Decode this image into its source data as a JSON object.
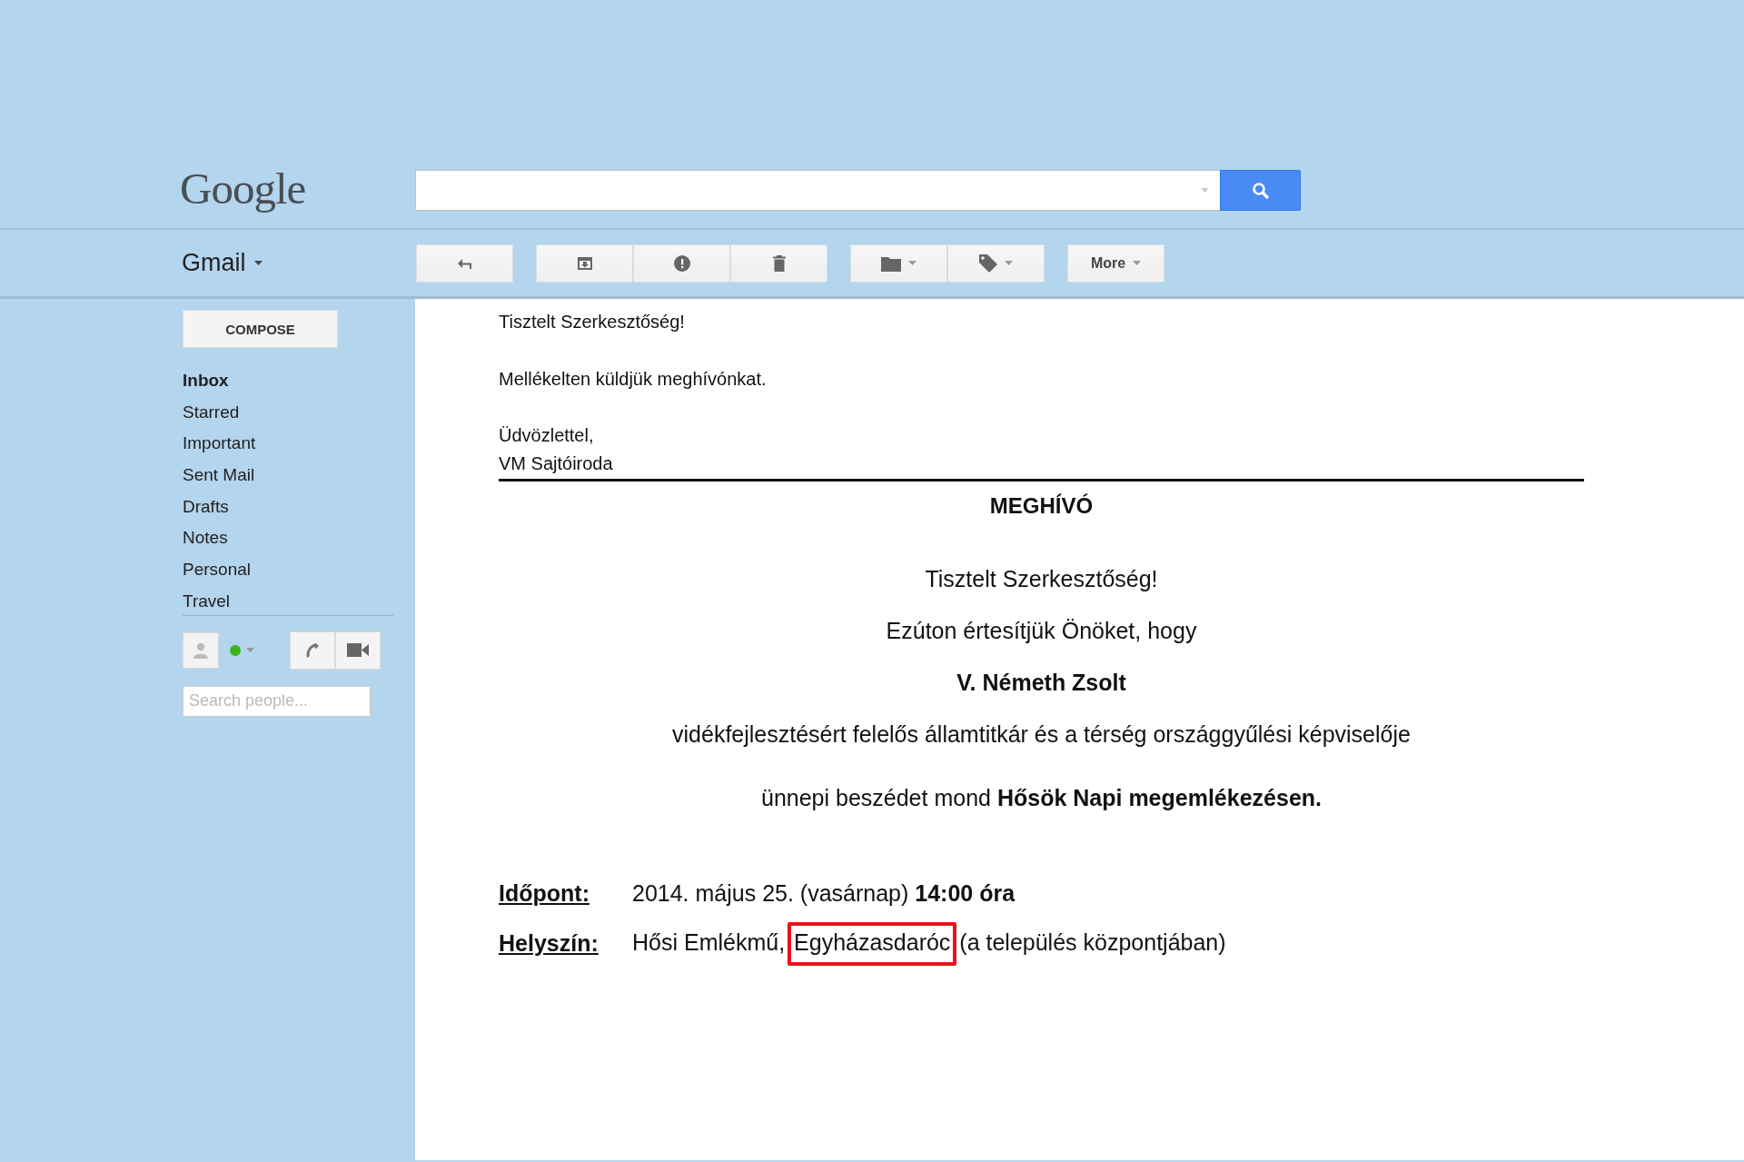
{
  "header": {
    "logo": "Google"
  },
  "app": {
    "title": "Gmail"
  },
  "toolbar": {
    "groups": [
      [
        {
          "kind": "reply"
        }
      ],
      [
        {
          "kind": "archive"
        },
        {
          "kind": "spam"
        },
        {
          "kind": "delete"
        }
      ],
      [
        {
          "kind": "folder"
        },
        {
          "kind": "label"
        }
      ],
      [
        {
          "kind": "more",
          "label": "More"
        }
      ]
    ]
  },
  "sidebar": {
    "compose": "COMPOSE",
    "items": [
      {
        "label": "Inbox",
        "selected": true
      },
      {
        "label": "Starred",
        "selected": false
      },
      {
        "label": "Important",
        "selected": false
      },
      {
        "label": "Sent Mail",
        "selected": false
      },
      {
        "label": "Drafts",
        "selected": false
      },
      {
        "label": "Notes",
        "selected": false
      },
      {
        "label": "Personal",
        "selected": false
      },
      {
        "label": "Travel",
        "selected": false
      }
    ],
    "people_search": {
      "placeholder": "Search people..."
    }
  },
  "message": {
    "intro": [
      "Tisztelt Szerkesztőség!",
      "Mellékelten küldjük meghívónkat."
    ],
    "signature": [
      "Üdvözlettel,",
      "VM Sajtóiroda"
    ],
    "invitation": {
      "title": "MEGHÍVÓ",
      "lines": [
        "Tisztelt Szerkesztőség!",
        "Ezúton értesítjük Önöket, hogy",
        "**V. Németh Zsolt**",
        "vidékfejlesztésért felelős államtitkár és a térség országgyűlési képviselője",
        "ünnepi beszédet mond **Hősök Napi megemlékezésen.**"
      ],
      "details": [
        {
          "label": "Időpont:",
          "value": "2014. május 25. (vasárnap) **14:00 óra**"
        },
        {
          "label": "Helyszín:",
          "value_before": "Hősi Emlékmű,",
          "value_highlighted": "Egyházasdaróc",
          "value_after": "(a település központjában)"
        }
      ]
    }
  }
}
